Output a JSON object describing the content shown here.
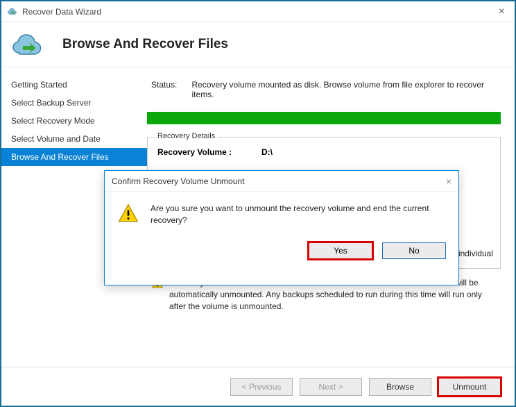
{
  "window": {
    "title": "Recover Data Wizard"
  },
  "header": {
    "title": "Browse And Recover Files"
  },
  "sidebar": {
    "items": [
      {
        "label": "Getting Started"
      },
      {
        "label": "Select Backup Server"
      },
      {
        "label": "Select Recovery Mode"
      },
      {
        "label": "Select Volume and Date"
      },
      {
        "label": "Browse And Recover Files"
      }
    ],
    "active_index": 4
  },
  "status": {
    "label": "Status:",
    "text": "Recovery volume mounted as disk. Browse volume from file explorer to recover items."
  },
  "recovery_details": {
    "legend": "Recovery Details",
    "volume_label": "Recovery Volume   :",
    "volume_value": "D:\\"
  },
  "hint_partial": "cover individual",
  "mount_note": {
    "text": "Recovery volume will remain mounted till 1/31/2017 8:44:48 AM after which it will be automatically unmounted. Any backups scheduled to run during this time will run only after the volume is unmounted."
  },
  "footer": {
    "previous": "< Previous",
    "next": "Next >",
    "browse": "Browse",
    "unmount": "Unmount"
  },
  "dialog": {
    "title": "Confirm Recovery Volume Unmount",
    "message": "Are you sure you want to unmount the recovery volume and end the current recovery?",
    "yes": "Yes",
    "no": "No"
  }
}
